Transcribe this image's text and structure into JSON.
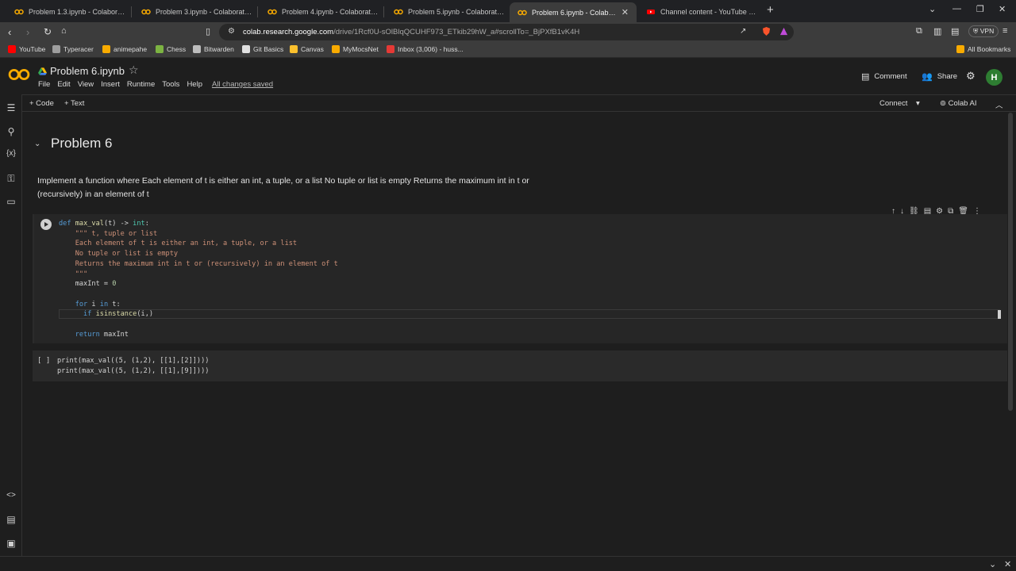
{
  "browser": {
    "tabs": [
      {
        "label": "Problem 1.3.ipynb - Colaboratory",
        "active": false
      },
      {
        "label": "Problem 3.ipynb - Colaboratory",
        "active": false
      },
      {
        "label": "Problem 4.ipynb - Colaboratory",
        "active": false
      },
      {
        "label": "Problem 5.ipynb - Colaboratory",
        "active": false
      },
      {
        "label": "Problem 6.ipynb - Colaboratory",
        "active": true
      },
      {
        "label": "Channel content - YouTube Studio",
        "active": false
      }
    ],
    "new_tab": "+",
    "url_host": "colab.research.google.com",
    "url_path": "/drive/1Rcf0U-sOlBlqQCUHF973_ETkib29hW_a#scrollTo=_BjPXfB1vK4H",
    "vpn": "VPN",
    "bookmarks": [
      "YouTube",
      "Typeracer",
      "animepahe",
      "Chess",
      "Bitwarden",
      "Git Basics",
      "Canvas",
      "MyMocsNet",
      "Inbox (3,006) - huss..."
    ],
    "all_bookmarks": "All Bookmarks"
  },
  "colab": {
    "notebook_title": "Problem 6.ipynb",
    "menu": [
      "File",
      "Edit",
      "View",
      "Insert",
      "Runtime",
      "Tools",
      "Help"
    ],
    "saved_status": "All changes saved",
    "comment": "Comment",
    "share": "Share",
    "avatar_letter": "H",
    "add_code": "+ Code",
    "add_text": "+ Text",
    "connect": "Connect",
    "colab_ai": "Colab AI"
  },
  "notebook": {
    "heading": "Problem 6",
    "description_line1": "Implement a function where Each element of t is either an int, a tuple, or a list No tuple or list is empty Returns the maximum int in t or",
    "description_line2": "(recursively) in an element of t",
    "cell2_bracket": "[ ]",
    "cell2_lines": [
      "print(max_val((5, (1,2), [[1],[2]])))",
      "print(max_val((5, (1,2), [[1],[9]])))"
    ]
  },
  "colors": {
    "accent_orange": "#f9ab00",
    "avatar_green": "#2e7d32",
    "keyword_blue": "#569cd6",
    "string_orange": "#ce9178"
  }
}
